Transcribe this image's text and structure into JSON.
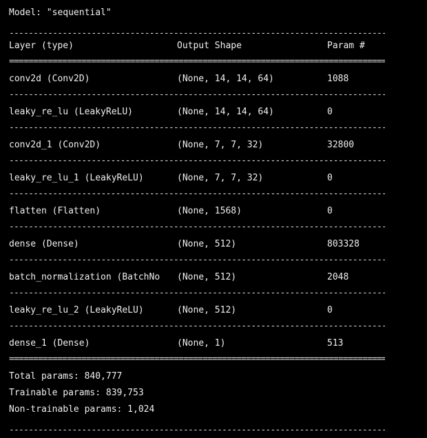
{
  "model_line": "Model: \"sequential\"",
  "headers": {
    "layer": "Layer (type)",
    "shape": "Output Shape",
    "params": "Param #"
  },
  "rows": [
    {
      "layer": "conv2d (Conv2D)",
      "shape": "(None, 14, 14, 64)",
      "params": "1088"
    },
    {
      "layer": "leaky_re_lu (LeakyReLU)",
      "shape": "(None, 14, 14, 64)",
      "params": "0"
    },
    {
      "layer": "conv2d_1 (Conv2D)",
      "shape": "(None, 7, 7, 32)",
      "params": "32800"
    },
    {
      "layer": "leaky_re_lu_1 (LeakyReLU)",
      "shape": "(None, 7, 7, 32)",
      "params": "0"
    },
    {
      "layer": "flatten (Flatten)",
      "shape": "(None, 1568)",
      "params": "0"
    },
    {
      "layer": "dense (Dense)",
      "shape": "(None, 512)",
      "params": "803328"
    },
    {
      "layer": "batch_normalization (BatchNo",
      "shape": "(None, 512)",
      "params": "2048"
    },
    {
      "layer": "leaky_re_lu_2 (LeakyReLU)",
      "shape": "(None, 512)",
      "params": "0"
    },
    {
      "layer": "dense_1 (Dense)",
      "shape": "(None, 1)",
      "params": "513"
    }
  ],
  "totals": {
    "total": "Total params: 840,777",
    "trainable": "Trainable params: 839,753",
    "non_trainable": "Non-trainable params: 1,024"
  },
  "colors": {
    "background": "#000000",
    "text": "#f0f0f0"
  }
}
